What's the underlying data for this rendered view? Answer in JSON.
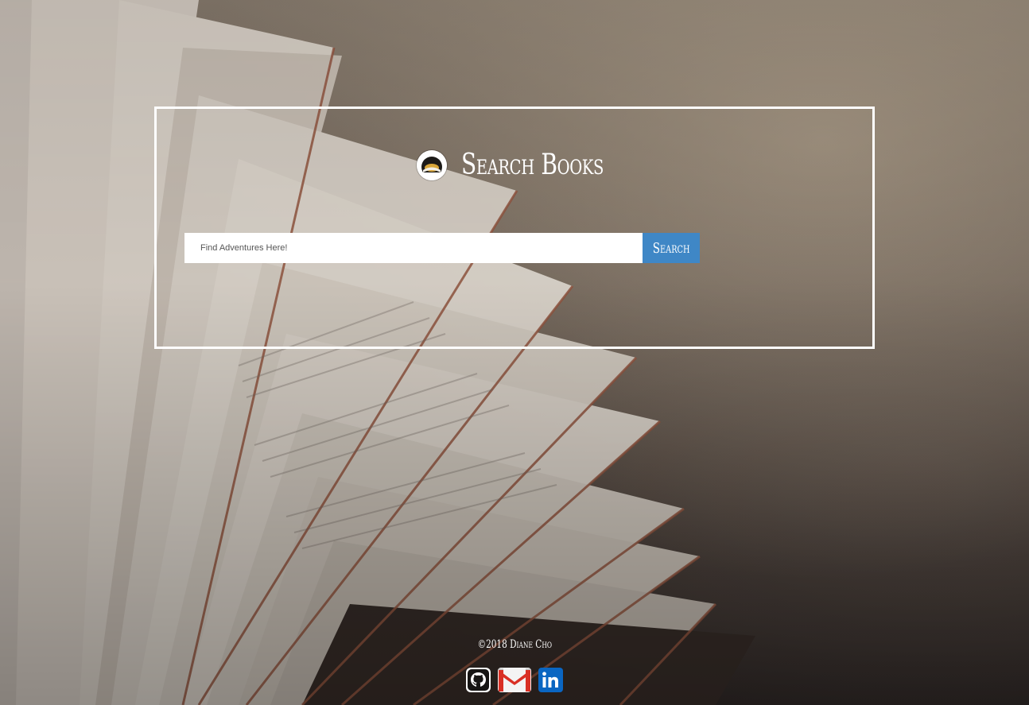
{
  "header": {
    "title": "Search Books",
    "logo_icon": "open-book-icon"
  },
  "search": {
    "placeholder": "Find Adventures Here!",
    "value": "",
    "button_label": "Search",
    "button_color": "#3f87c6"
  },
  "footer": {
    "copyright": "©2018 Diane Cho",
    "links": [
      {
        "icon": "github-icon"
      },
      {
        "icon": "gmail-icon"
      },
      {
        "icon": "linkedin-icon"
      }
    ]
  }
}
